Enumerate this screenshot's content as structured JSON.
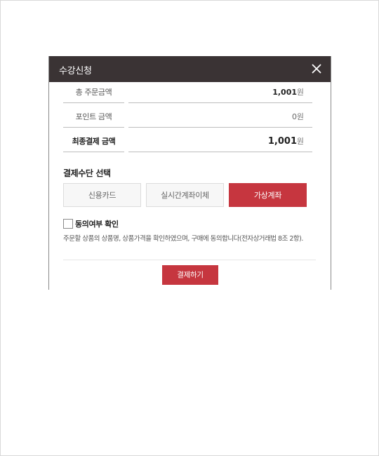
{
  "modal": {
    "title": "수강신청"
  },
  "summary": {
    "rows": [
      {
        "label": "총 주문금액",
        "value": "1,001",
        "unit": "원"
      },
      {
        "label": "포인트 금액",
        "value": "0",
        "unit": "원"
      },
      {
        "label": "최종결제 금액",
        "value": "1,001",
        "unit": "원"
      }
    ]
  },
  "payment": {
    "section_title": "결제수단 선택",
    "methods": [
      {
        "label": "신용카드",
        "selected": false
      },
      {
        "label": "실시간계좌이체",
        "selected": false
      },
      {
        "label": "가상계좌",
        "selected": true
      }
    ]
  },
  "agreement": {
    "label": "동의여부 확인",
    "checked": false,
    "description": "주문할 상품의 상품명, 상품가격을 확인하였으며, 구매에 동의합니다(전자상거래법 8조 2항)."
  },
  "actions": {
    "submit_label": "결제하기"
  },
  "icons": {
    "close": "close-icon"
  },
  "colors": {
    "header_bg": "#3a3334",
    "accent": "#c6363f"
  }
}
